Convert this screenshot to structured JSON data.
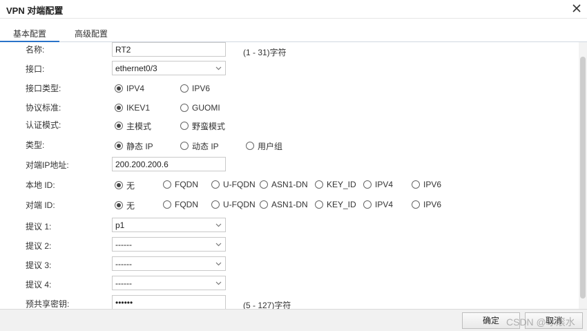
{
  "window": {
    "title": "VPN 对端配置"
  },
  "tabs": [
    {
      "label": "基本配置"
    },
    {
      "label": "高级配置"
    }
  ],
  "form": {
    "name": {
      "label": "名称:",
      "value": "RT2",
      "hint": "(1 - 31)字符"
    },
    "interface": {
      "label": "接口:",
      "value": "ethernet0/3"
    },
    "interface_type": {
      "label": "接口类型:",
      "options": [
        "IPV4",
        "IPV6"
      ],
      "selected": "IPV4"
    },
    "protocol": {
      "label": "协议标准:",
      "options": [
        "IKEV1",
        "GUOMI"
      ],
      "selected": "IKEV1"
    },
    "auth_mode": {
      "label": "认证模式:",
      "options": [
        "主模式",
        "野蛮模式"
      ],
      "selected": "主模式"
    },
    "type": {
      "label": "类型:",
      "options": [
        "静态 IP",
        "动态 IP",
        "用户组"
      ],
      "selected": "静态 IP"
    },
    "peer_ip": {
      "label": "对端IP地址:",
      "value": "200.200.200.6"
    },
    "local_id": {
      "label": "本地 ID:",
      "options": [
        "无",
        "FQDN",
        "U-FQDN",
        "ASN1-DN",
        "KEY_ID",
        "IPV4",
        "IPV6"
      ],
      "selected": "无"
    },
    "peer_id": {
      "label": "对端 ID:",
      "options": [
        "无",
        "FQDN",
        "U-FQDN",
        "ASN1-DN",
        "KEY_ID",
        "IPV4",
        "IPV6"
      ],
      "selected": "无"
    },
    "proposal1": {
      "label": "提议 1:",
      "value": "p1"
    },
    "proposal2": {
      "label": "提议 2:",
      "value": "------"
    },
    "proposal3": {
      "label": "提议 3:",
      "value": "------"
    },
    "proposal4": {
      "label": "提议 4:",
      "value": "------"
    },
    "psk": {
      "label": "预共享密钥:",
      "value": "••••••",
      "hint": "(5 - 127)字符"
    }
  },
  "footer": {
    "ok": "确定",
    "cancel": "取消"
  },
  "watermark": "CSDN @冰滚水",
  "icons": {
    "close": "close-icon",
    "caret": "chevron-down-icon"
  },
  "colors": {
    "tab_accent": "#2a73c8"
  }
}
